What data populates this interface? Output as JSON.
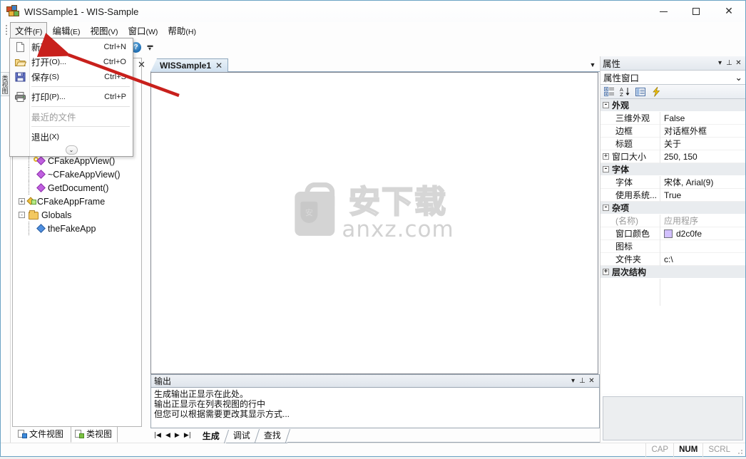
{
  "window": {
    "title": "WISSample1 - WIS-Sample",
    "app_icon": "windows-blocks-icon",
    "controls": {
      "minimize": "–",
      "maximize": "□",
      "close": "✕"
    }
  },
  "menubar": {
    "items": [
      {
        "label": "文件",
        "accel": "(F)",
        "open": true
      },
      {
        "label": "编辑",
        "accel": "(E)",
        "open": false
      },
      {
        "label": "视图",
        "accel": "(V)",
        "open": false
      },
      {
        "label": "窗口",
        "accel": "(W)",
        "open": false
      },
      {
        "label": "帮助",
        "accel": "(H)",
        "open": false
      }
    ]
  },
  "file_menu": {
    "items": [
      {
        "label": "新建",
        "accel": "(N)",
        "shortcut": "Ctrl+N",
        "icon": "new-document-icon",
        "disabled": false
      },
      {
        "label": "打开",
        "accel": "(O)...",
        "shortcut": "Ctrl+O",
        "icon": "open-folder-icon",
        "disabled": false
      },
      {
        "label": "保存",
        "accel": "(S)",
        "shortcut": "Ctrl+S",
        "icon": "save-floppy-icon",
        "disabled": false
      },
      {
        "label": "打印",
        "accel": "(P)...",
        "shortcut": "Ctrl+P",
        "icon": "printer-icon",
        "disabled": false
      },
      {
        "label": "最近的文件",
        "accel": "",
        "shortcut": "",
        "icon": "",
        "disabled": true
      },
      {
        "label": "退出",
        "accel": "(X)",
        "shortcut": "",
        "icon": "",
        "disabled": false
      }
    ],
    "expand_glyph": "⌄⌄"
  },
  "toolbar": {
    "help_icon": "help-question-icon",
    "overflow_glyph": "▾"
  },
  "left_dock": {
    "edge_tab_label": "类视图"
  },
  "tree": {
    "nodes": [
      {
        "label": "CFakeAppView()",
        "icon": "method-diamond-icon",
        "depth": 2,
        "expander": "",
        "key": true
      },
      {
        "label": "~CFakeAppView()",
        "icon": "method-diamond-icon",
        "depth": 2,
        "expander": "",
        "key": false
      },
      {
        "label": "GetDocument()",
        "icon": "method-diamond-icon",
        "depth": 2,
        "expander": "",
        "key": false
      },
      {
        "label": "CFakeAppFrame",
        "icon": "class-icon",
        "depth": 1,
        "expander": "+",
        "key": false
      },
      {
        "label": "Globals",
        "icon": "folder-icon",
        "depth": 1,
        "expander": "-",
        "key": false
      },
      {
        "label": "theFakeApp",
        "icon": "variable-diamond-icon",
        "depth": 2,
        "expander": "",
        "key": false
      }
    ],
    "view_tabs": [
      {
        "label": "文件视图",
        "active": false,
        "icon": "file-view-icon"
      },
      {
        "label": "类视图",
        "active": true,
        "icon": "class-view-icon"
      }
    ]
  },
  "document": {
    "tabs": [
      {
        "label": "WISSample1",
        "close_glyph": "✕",
        "active": true
      }
    ],
    "close_all_glyph": "✕",
    "dropdown_glyph": "▼",
    "watermark": {
      "cn": "安下载",
      "en": "anxz.com",
      "shield_text": "安"
    }
  },
  "output": {
    "title": "输出",
    "header_buttons": {
      "dropdown": "▾",
      "pin": "⊥",
      "close": "✕"
    },
    "lines": [
      "生成输出正显示在此处。",
      "输出正显示在列表视图的行中",
      "但您可以根据需要更改其显示方式..."
    ],
    "nav": [
      "|◀",
      "◀",
      "▶",
      "▶|"
    ],
    "tabs": [
      {
        "label": "生成",
        "active": true
      },
      {
        "label": "调试",
        "active": false
      },
      {
        "label": "查找",
        "active": false
      }
    ]
  },
  "properties": {
    "title": "属性",
    "header_buttons": {
      "dropdown": "▾",
      "pin": "⊥",
      "close": "✕"
    },
    "object_combo": {
      "value": "属性窗口",
      "chevron": "⌄"
    },
    "toolbar_icons": [
      "categorized-icon",
      "alphabetical-sort-icon",
      "properties-page-icon",
      "events-lightning-icon"
    ],
    "groups": [
      {
        "name": "外观",
        "expander": "-",
        "rows": [
          {
            "key": "三维外观",
            "value": "False",
            "expander": "",
            "swatch": ""
          },
          {
            "key": "边框",
            "value": "对话框外框",
            "expander": "",
            "swatch": ""
          },
          {
            "key": "标题",
            "value": "关于",
            "expander": "",
            "swatch": ""
          },
          {
            "key": "窗口大小",
            "value": "250, 150",
            "expander": "+",
            "swatch": ""
          }
        ]
      },
      {
        "name": "字体",
        "expander": "-",
        "rows": [
          {
            "key": "字体",
            "value": "宋体, Arial(9)",
            "expander": "",
            "swatch": ""
          },
          {
            "key": "使用系统...",
            "value": "True",
            "expander": "",
            "swatch": ""
          }
        ]
      },
      {
        "name": "杂项",
        "expander": "-",
        "rows": [
          {
            "key": "(名称)",
            "value": "应用程序",
            "expander": "",
            "swatch": "",
            "gray": true
          },
          {
            "key": "窗口颜色",
            "value": "d2c0fe",
            "expander": "",
            "swatch": "#d2c0fe"
          },
          {
            "key": "图标",
            "value": "",
            "expander": "",
            "swatch": ""
          },
          {
            "key": "文件夹",
            "value": "c:\\",
            "expander": "",
            "swatch": ""
          }
        ]
      },
      {
        "name": "层次结构",
        "expander": "+",
        "rows": []
      }
    ]
  },
  "statusbar": {
    "cells": [
      {
        "label": "CAP",
        "active": false
      },
      {
        "label": "NUM",
        "active": true
      },
      {
        "label": "SCRL",
        "active": false
      }
    ]
  },
  "colors": {
    "accent_border": "#6ba3c4",
    "swatch_window_color": "#d2c0fe",
    "annotation_arrow": "#c8201c"
  }
}
